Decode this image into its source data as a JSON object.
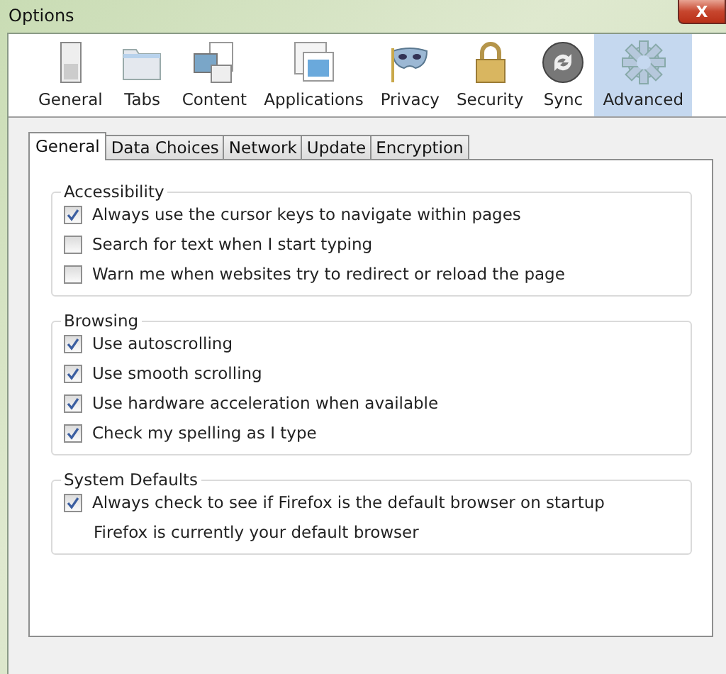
{
  "window": {
    "title": "Options",
    "close": "X"
  },
  "toolbar": [
    {
      "label": "General",
      "kind": "switch",
      "selected": false
    },
    {
      "label": "Tabs",
      "kind": "folder",
      "selected": false
    },
    {
      "label": "Content",
      "kind": "content",
      "selected": false
    },
    {
      "label": "Applications",
      "kind": "apps",
      "selected": false
    },
    {
      "label": "Privacy",
      "kind": "mask",
      "selected": false
    },
    {
      "label": "Security",
      "kind": "lock",
      "selected": false
    },
    {
      "label": "Sync",
      "kind": "sync",
      "selected": false
    },
    {
      "label": "Advanced",
      "kind": "gear",
      "selected": true
    }
  ],
  "tabs": [
    {
      "label": "General",
      "selected": true
    },
    {
      "label": "Data Choices",
      "selected": false
    },
    {
      "label": "Network",
      "selected": false
    },
    {
      "label": "Update",
      "selected": false
    },
    {
      "label": "Encryption",
      "selected": false
    }
  ],
  "groups": [
    {
      "title": "Accessibility",
      "items": [
        {
          "kind": "checkbox",
          "label": "Always use the cursor keys to navigate within pages",
          "checked": true
        },
        {
          "kind": "checkbox",
          "label": "Search for text when I start typing",
          "checked": false
        },
        {
          "kind": "checkbox",
          "label": "Warn me when websites try to redirect or reload the page",
          "checked": false
        }
      ]
    },
    {
      "title": "Browsing",
      "items": [
        {
          "kind": "checkbox",
          "label": "Use autoscrolling",
          "checked": true
        },
        {
          "kind": "checkbox",
          "label": "Use smooth scrolling",
          "checked": true
        },
        {
          "kind": "checkbox",
          "label": "Use hardware acceleration when available",
          "checked": true
        },
        {
          "kind": "checkbox",
          "label": "Check my spelling as I type",
          "checked": true
        }
      ]
    },
    {
      "title": "System Defaults",
      "items": [
        {
          "kind": "checkbox",
          "label": "Always check to see if Firefox is the default browser on startup",
          "checked": true
        },
        {
          "kind": "note",
          "label": "Firefox is currently your default browser"
        }
      ]
    }
  ]
}
